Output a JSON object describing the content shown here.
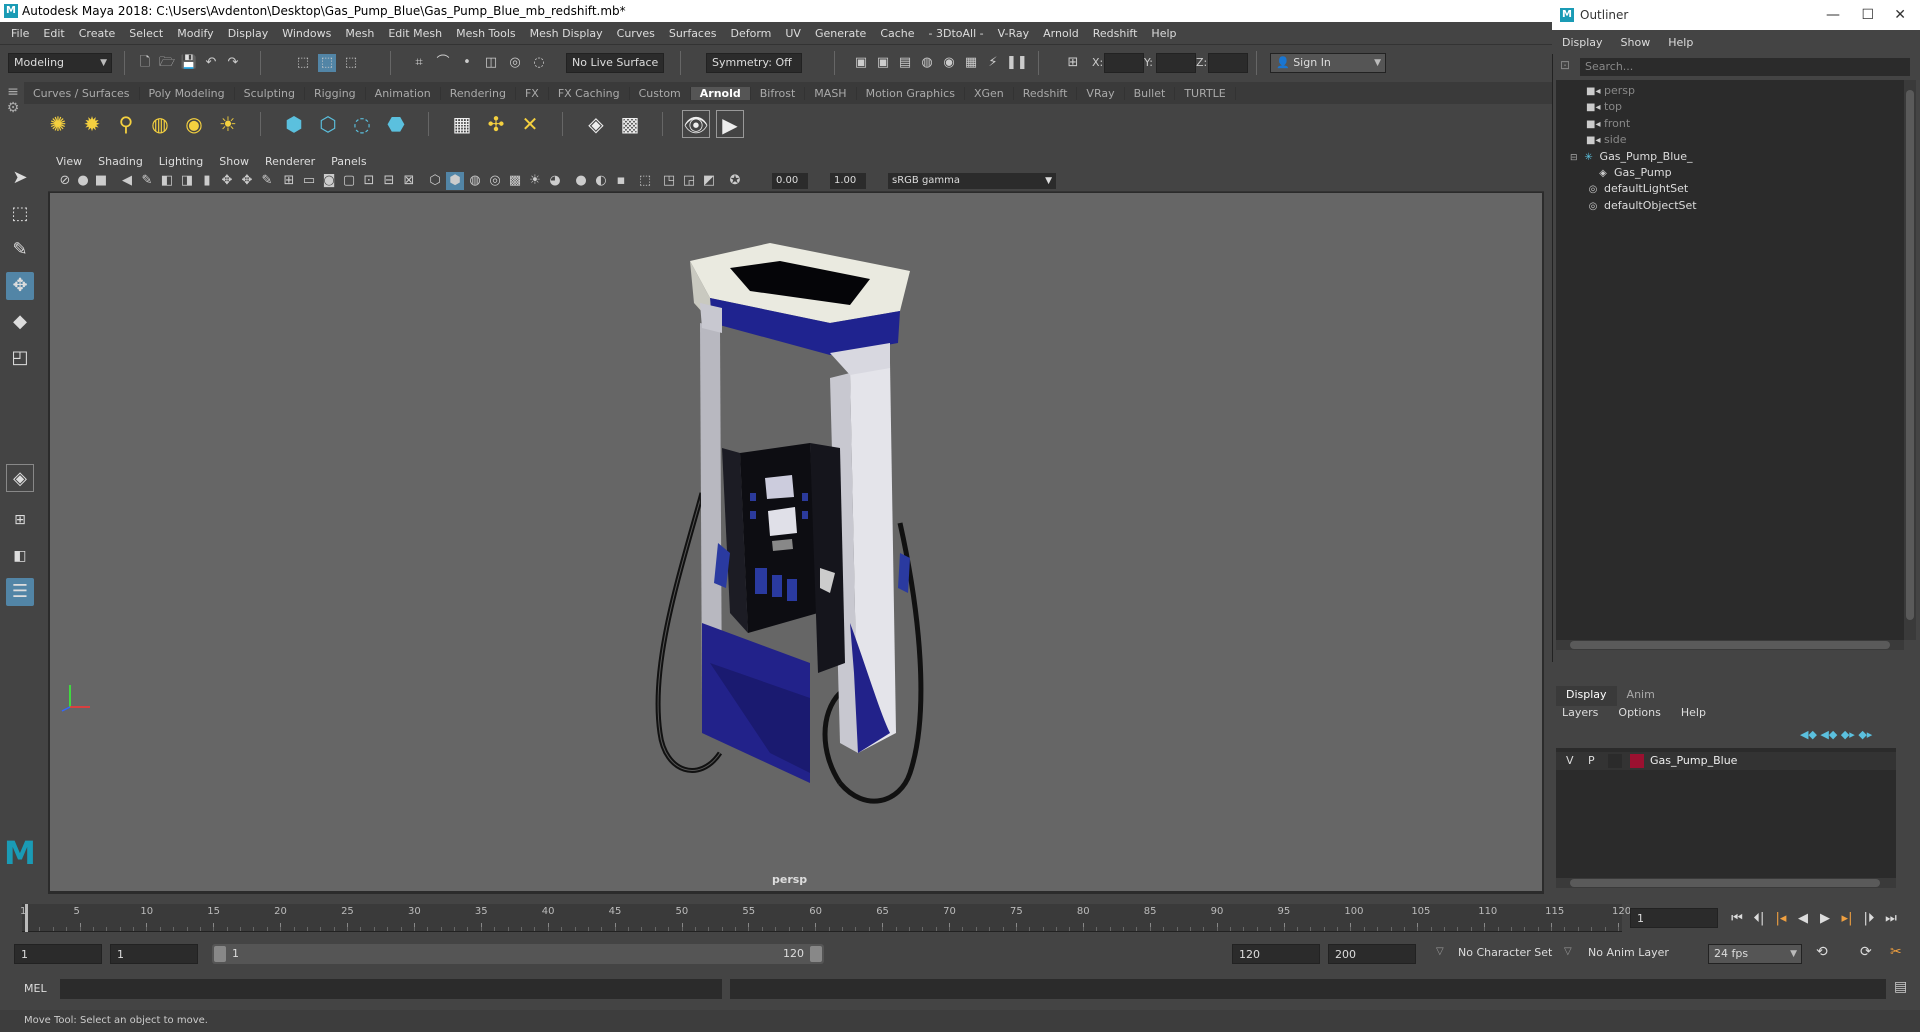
{
  "title_bar": {
    "title": "Autodesk Maya 2018: C:\\Users\\Avdenton\\Desktop\\Gas_Pump_Blue\\Gas_Pump_Blue_mb_redshift.mb*"
  },
  "menu_bar": {
    "items": [
      "File",
      "Edit",
      "Create",
      "Select",
      "Modify",
      "Display",
      "Windows",
      "Mesh",
      "Edit Mesh",
      "Mesh Tools",
      "Mesh Display",
      "Curves",
      "Surfaces",
      "Deform",
      "UV",
      "Generate",
      "Cache",
      "- 3DtoAll -",
      "V-Ray",
      "Arnold",
      "Redshift",
      "Help"
    ]
  },
  "status_line": {
    "mode": "Modeling",
    "live_surface": "No Live Surface",
    "symmetry": "Symmetry: Off",
    "x_label": "X:",
    "y_label": "Y:",
    "z_label": "Z:",
    "sign_in": "Sign In"
  },
  "shelf": {
    "tabs": [
      "Curves / Surfaces",
      "Poly Modeling",
      "Sculpting",
      "Rigging",
      "Animation",
      "Rendering",
      "FX",
      "FX Caching",
      "Custom",
      "Arnold",
      "Bifrost",
      "MASH",
      "Motion Graphics",
      "XGen",
      "Redshift",
      "VRay",
      "Bullet",
      "TURTLE"
    ],
    "active_tab": "Arnold"
  },
  "viewport": {
    "menu": [
      "View",
      "Shading",
      "Lighting",
      "Show",
      "Renderer",
      "Panels"
    ],
    "exposure": "0.00",
    "gamma": "1.00",
    "color_space": "sRGB gamma",
    "camera_label": "persp"
  },
  "outliner": {
    "title": "Outliner",
    "menu": [
      "Display",
      "Show",
      "Help"
    ],
    "search_placeholder": "Search...",
    "items": [
      {
        "label": "persp",
        "icon": "camera-icon",
        "dim": true
      },
      {
        "label": "top",
        "icon": "camera-icon",
        "dim": true
      },
      {
        "label": "front",
        "icon": "camera-icon",
        "dim": true
      },
      {
        "label": "side",
        "icon": "camera-icon",
        "dim": true
      },
      {
        "label": "Gas_Pump_Blue_",
        "icon": "group-icon",
        "dim": false
      },
      {
        "label": "Gas_Pump",
        "icon": "mesh-icon",
        "dim": false
      },
      {
        "label": "defaultLightSet",
        "icon": "set-icon",
        "dim": false
      },
      {
        "label": "defaultObjectSet",
        "icon": "set-icon",
        "dim": false
      }
    ]
  },
  "layer_editor": {
    "tabs": [
      "Display",
      "Anim"
    ],
    "menu": [
      "Layers",
      "Options",
      "Help"
    ],
    "layer": {
      "v": "V",
      "p": "P",
      "name": "Gas_Pump_Blue",
      "color": "#9b1030"
    }
  },
  "time_slider": {
    "ticks": [
      "1",
      "5",
      "10",
      "15",
      "20",
      "25",
      "30",
      "35",
      "40",
      "45",
      "50",
      "55",
      "60",
      "65",
      "70",
      "75",
      "80",
      "85",
      "90",
      "95",
      "100",
      "105",
      "110",
      "115",
      "120"
    ],
    "current_frame": "1"
  },
  "range_slider": {
    "start": "1",
    "playback_start": "1",
    "range_start_label": "1",
    "range_end_label": "120",
    "playback_end": "120",
    "end": "200",
    "character_set": "No Character Set",
    "anim_layer": "No Anim Layer",
    "fps": "24 fps"
  },
  "command_line": {
    "label": "MEL"
  },
  "help_line": {
    "text": "Move Tool: Select an object to move."
  }
}
